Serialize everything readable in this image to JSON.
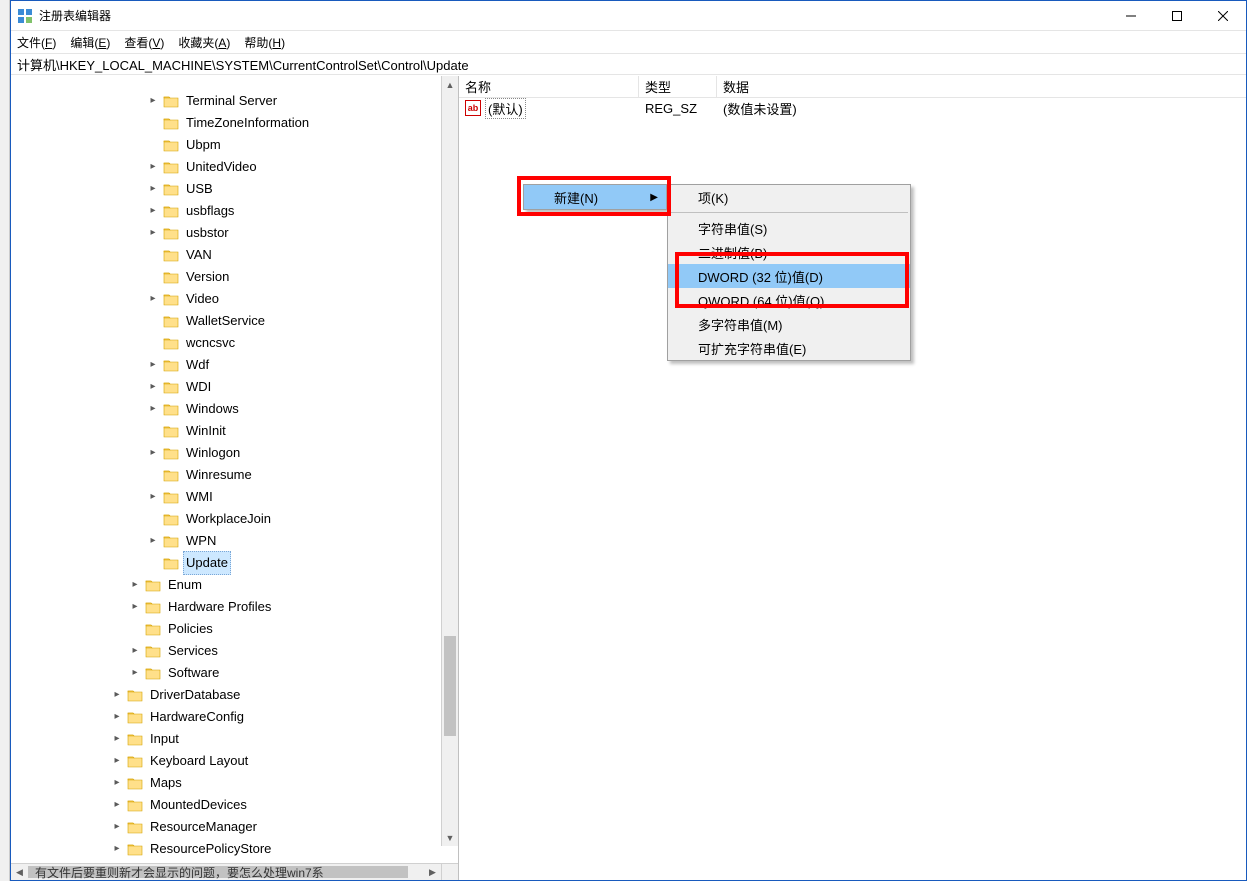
{
  "window": {
    "title": "注册表编辑器"
  },
  "menu": {
    "file": "文件(F)",
    "edit": "编辑(E)",
    "view": "查看(V)",
    "favorites": "收藏夹(A)",
    "help": "帮助(H)"
  },
  "addressbar": "计算机\\HKEY_LOCAL_MACHINE\\SYSTEM\\CurrentControlSet\\Control\\Update",
  "columns": {
    "name": "名称",
    "type": "类型",
    "data": "数据"
  },
  "rows": [
    {
      "name": "(默认)",
      "type": "REG_SZ",
      "data": "(数值未设置)"
    }
  ],
  "tree": [
    {
      "indent": 5,
      "expand": ">",
      "label": "Terminal Server"
    },
    {
      "indent": 5,
      "expand": "",
      "label": "TimeZoneInformation"
    },
    {
      "indent": 5,
      "expand": "",
      "label": "Ubpm"
    },
    {
      "indent": 5,
      "expand": ">",
      "label": "UnitedVideo"
    },
    {
      "indent": 5,
      "expand": ">",
      "label": "USB"
    },
    {
      "indent": 5,
      "expand": ">",
      "label": "usbflags"
    },
    {
      "indent": 5,
      "expand": ">",
      "label": "usbstor"
    },
    {
      "indent": 5,
      "expand": "",
      "label": "VAN"
    },
    {
      "indent": 5,
      "expand": "",
      "label": "Version"
    },
    {
      "indent": 5,
      "expand": ">",
      "label": "Video"
    },
    {
      "indent": 5,
      "expand": "",
      "label": "WalletService"
    },
    {
      "indent": 5,
      "expand": "",
      "label": "wcncsvc"
    },
    {
      "indent": 5,
      "expand": ">",
      "label": "Wdf"
    },
    {
      "indent": 5,
      "expand": ">",
      "label": "WDI"
    },
    {
      "indent": 5,
      "expand": ">",
      "label": "Windows"
    },
    {
      "indent": 5,
      "expand": "",
      "label": "WinInit"
    },
    {
      "indent": 5,
      "expand": ">",
      "label": "Winlogon"
    },
    {
      "indent": 5,
      "expand": "",
      "label": "Winresume"
    },
    {
      "indent": 5,
      "expand": ">",
      "label": "WMI"
    },
    {
      "indent": 5,
      "expand": "",
      "label": "WorkplaceJoin"
    },
    {
      "indent": 5,
      "expand": ">",
      "label": "WPN"
    },
    {
      "indent": 5,
      "expand": "",
      "label": "Update",
      "selected": true
    },
    {
      "indent": 4,
      "expand": ">",
      "label": "Enum"
    },
    {
      "indent": 4,
      "expand": ">",
      "label": "Hardware Profiles"
    },
    {
      "indent": 4,
      "expand": "",
      "label": "Policies"
    },
    {
      "indent": 4,
      "expand": ">",
      "label": "Services"
    },
    {
      "indent": 4,
      "expand": ">",
      "label": "Software"
    },
    {
      "indent": 3,
      "expand": ">",
      "label": "DriverDatabase"
    },
    {
      "indent": 3,
      "expand": ">",
      "label": "HardwareConfig"
    },
    {
      "indent": 3,
      "expand": ">",
      "label": "Input"
    },
    {
      "indent": 3,
      "expand": ">",
      "label": "Keyboard Layout"
    },
    {
      "indent": 3,
      "expand": ">",
      "label": "Maps"
    },
    {
      "indent": 3,
      "expand": ">",
      "label": "MountedDevices"
    },
    {
      "indent": 3,
      "expand": ">",
      "label": "ResourceManager"
    },
    {
      "indent": 3,
      "expand": ">",
      "label": "ResourcePolicyStore",
      "clipped": true
    }
  ],
  "context_primary": {
    "new": "新建(N)"
  },
  "context_sub": {
    "key": "项(K)",
    "string": "字符串值(S)",
    "binary": "二进制值(B)",
    "dword": "DWORD (32 位)值(D)",
    "qword": "QWORD (64 位)值(Q)",
    "multistring": "多字符串值(M)",
    "expandstring": "可扩充字符串值(E)"
  },
  "bottom_caption": "有文件后要重则新才会显示的问题，要怎么处理win7系"
}
